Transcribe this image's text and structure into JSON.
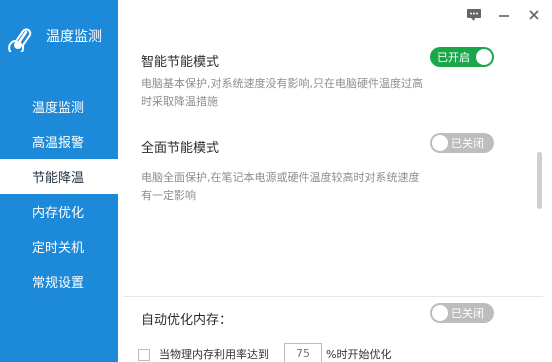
{
  "app": {
    "title": "温度监测"
  },
  "sidebar": {
    "items": [
      {
        "label": "温度监测"
      },
      {
        "label": "高温报警"
      },
      {
        "label": "节能降温"
      },
      {
        "label": "内存优化"
      },
      {
        "label": "定时关机"
      },
      {
        "label": "常规设置"
      }
    ],
    "active_index": 2
  },
  "window_controls": {
    "menu_icon": "menu-chat-icon",
    "minimize_icon": "minimize-icon",
    "close_icon": "close-icon"
  },
  "settings": {
    "smart_mode": {
      "title": "智能节能模式",
      "desc_line1": "电脑基本保护,对系统速度没有影响,只在电脑硬件温度过高",
      "desc_line2": "时采取降温措施",
      "toggle_label": "已开启"
    },
    "full_mode": {
      "title": "全面节能模式",
      "desc_line1": "电脑全面保护,在笔记本电源或硬件温度较高时对系统速度",
      "desc_line2": "有一定影响",
      "toggle_label": "已关闭"
    },
    "memory_optimize": {
      "title": "自动优化内存：",
      "toggle_label": "已关闭",
      "threshold_prefix": "当物理内存利用率达到",
      "threshold_value": "75",
      "threshold_suffix": "%时开始优化"
    }
  },
  "colors": {
    "sidebar_bg": "#1c8ad8",
    "toggle_on": "#1aa74a",
    "toggle_off": "#bdbdbd"
  }
}
